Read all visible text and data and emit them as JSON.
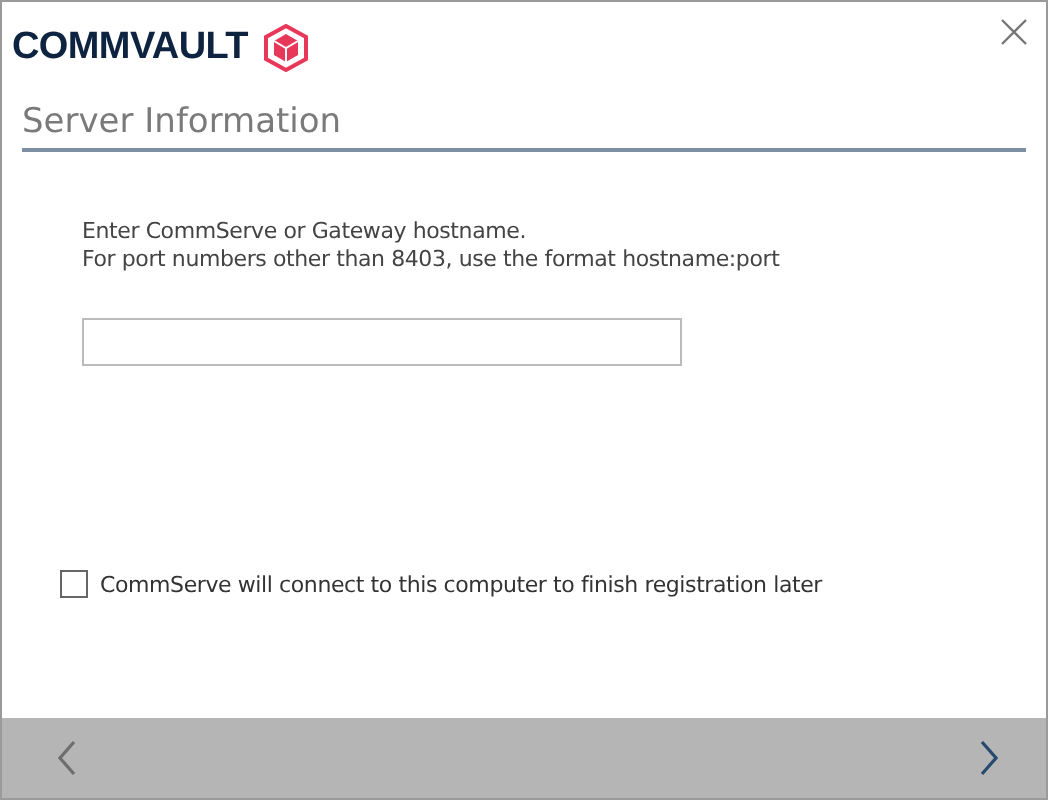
{
  "logo": {
    "text": "COMMVAULT"
  },
  "title": "Server Information",
  "instructions": [
    "Enter CommServe or Gateway hostname.",
    "For port numbers other than 8403, use the format hostname:port"
  ],
  "later_checkbox": {
    "label": "CommServe will connect to this computer to finish registration later",
    "checked": false
  },
  "nav": {
    "back_disabled": true,
    "next_disabled": false
  }
}
